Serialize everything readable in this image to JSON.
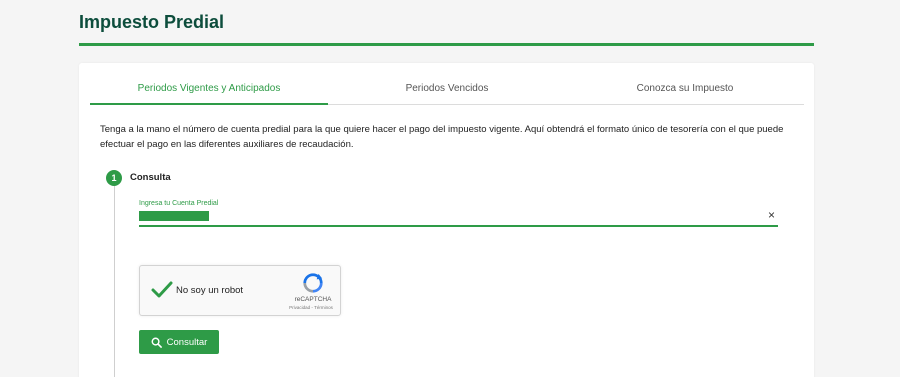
{
  "page": {
    "title": "Impuesto Predial"
  },
  "tabs": [
    {
      "label": "Periodos Vigentes y Anticipados",
      "active": true
    },
    {
      "label": "Periodos Vencidos",
      "active": false
    },
    {
      "label": "Conozca su Impuesto",
      "active": false
    }
  ],
  "intro": {
    "text": "Tenga a la mano el número de cuenta predial para la que quiere hacer el pago del impuesto vigente. Aquí obtendrá el formato único de tesorería con el que puede efectuar el pago en las diferentes auxiliares de recaudación."
  },
  "step": {
    "number": "1",
    "title": "Consulta"
  },
  "account_field": {
    "label": "Ingresa tu Cuenta Predial",
    "clear": "×"
  },
  "captcha": {
    "label": "No soy un robot",
    "brand": "reCAPTCHA",
    "terms": "Privacidad - Términos"
  },
  "submit": {
    "label": "Consultar"
  },
  "colors": {
    "accent": "#2e9b47",
    "title": "#0d4d3c"
  },
  "icons": {
    "submit": "search-icon",
    "captcha": "recaptcha-logo-icon",
    "check": "check-icon"
  }
}
